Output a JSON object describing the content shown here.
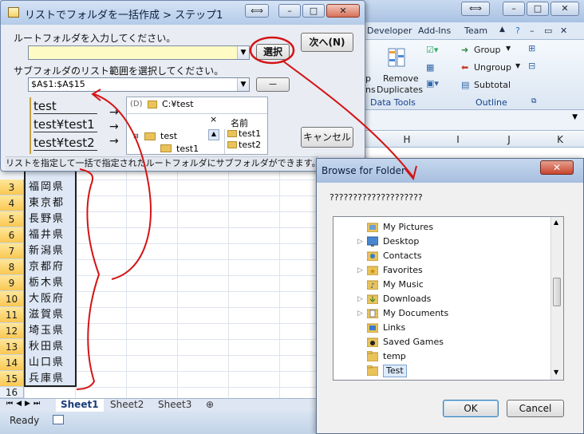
{
  "excel": {
    "ribbon_tabs": [
      "Developer",
      "Add-Ins",
      "Team"
    ],
    "ribbon": {
      "remove_duplicates": [
        "Remove",
        "Duplicates"
      ],
      "group": "Group",
      "ungroup": "Ungroup",
      "subtotal": "Subtotal",
      "data_tools_label": "Data Tools",
      "outline_label": "Outline",
      "partial_left": "p",
      "partial_left2": "ns"
    },
    "columns": [
      "H",
      "I",
      "J",
      "K"
    ],
    "rows": [
      {
        "num": "3",
        "value": "福岡県"
      },
      {
        "num": "4",
        "value": "東京都"
      },
      {
        "num": "5",
        "value": "長野県"
      },
      {
        "num": "6",
        "value": "福井県"
      },
      {
        "num": "7",
        "value": "新潟県"
      },
      {
        "num": "8",
        "value": "京都府"
      },
      {
        "num": "9",
        "value": "栃木県"
      },
      {
        "num": "10",
        "value": "大阪府"
      },
      {
        "num": "11",
        "value": "滋賀県"
      },
      {
        "num": "12",
        "value": "埼玉県"
      },
      {
        "num": "13",
        "value": "秋田県"
      },
      {
        "num": "14",
        "value": "山口県"
      },
      {
        "num": "15",
        "value": "兵庫県"
      }
    ],
    "row16": "16",
    "sheets": [
      "Sheet1",
      "Sheet2",
      "Sheet3"
    ],
    "status": "Ready"
  },
  "form": {
    "title": "リストでフォルダを一括作成 > ステップ1",
    "root_label": "ルートフォルダを入力してください。",
    "root_value": "",
    "select_button": "選択",
    "next_button": "次へ(N)",
    "sub_label": "サブフォルダのリスト範囲を選択してください。",
    "range_value": "$A$1:$A$15",
    "minus_button": "－",
    "cancel_button": "キャンセル",
    "sample_items": [
      "test",
      "test¥test1",
      "test¥test2"
    ],
    "arrows": [
      "→",
      "→",
      "→"
    ],
    "preview": {
      "path": "C:¥test",
      "tree_root": "test",
      "tree_child": "test1",
      "header_name": "名前",
      "files": [
        "test1",
        "test2"
      ]
    },
    "status": "リストを指定して一括で指定されたルートフォルダにサブフォルダができます。"
  },
  "browse": {
    "title": "Browse for Folder",
    "close": "✕",
    "prompt": "????????????????????",
    "folders": [
      {
        "name": "My Pictures",
        "expandable": false,
        "selected": false
      },
      {
        "name": "Desktop",
        "expandable": true,
        "selected": false
      },
      {
        "name": "Contacts",
        "expandable": false,
        "selected": false
      },
      {
        "name": "Favorites",
        "expandable": true,
        "selected": false
      },
      {
        "name": "My Music",
        "expandable": false,
        "selected": false
      },
      {
        "name": "Downloads",
        "expandable": true,
        "selected": false
      },
      {
        "name": "My Documents",
        "expandable": true,
        "selected": false
      },
      {
        "name": "Links",
        "expandable": false,
        "selected": false
      },
      {
        "name": "Saved Games",
        "expandable": false,
        "selected": false
      },
      {
        "name": "temp",
        "expandable": false,
        "selected": false
      },
      {
        "name": "Test",
        "expandable": false,
        "selected": true
      }
    ],
    "ok": "OK",
    "cancel": "Cancel"
  },
  "colors": {
    "annotation": "#d41414",
    "folder": "#e9c35a",
    "selection": "#dde7f5"
  }
}
